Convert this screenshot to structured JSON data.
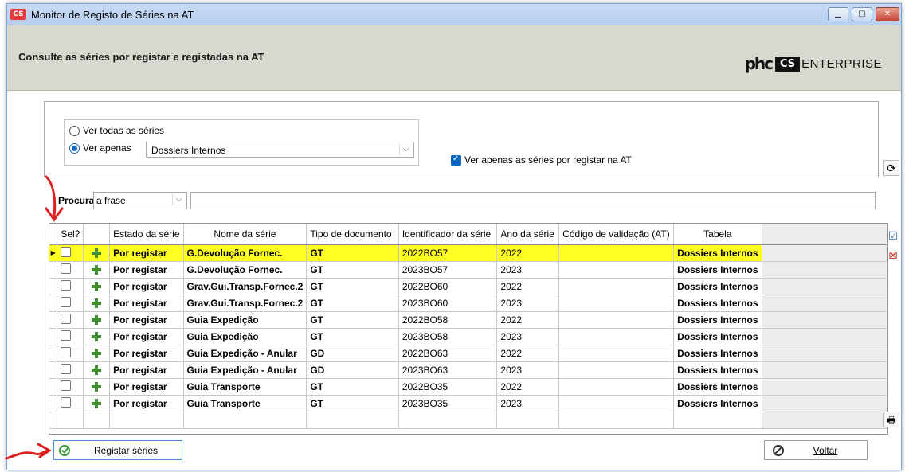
{
  "window": {
    "title": "Monitor de Registo de Séries na AT",
    "app_icon_text": "CS"
  },
  "header": {
    "title": "Consulte as séries por registar e registadas na AT",
    "logo": {
      "phc": "phc",
      "cs": "CS",
      "enterprise": "ENTERPRISE"
    }
  },
  "filters": {
    "radio_all_label": "Ver todas as séries",
    "radio_only_label": "Ver apenas",
    "selected_radio": "Ver apenas",
    "only_value": "Dossiers Internos",
    "register_only_label": "Ver apenas as séries por registar na AT",
    "register_only_checked": true
  },
  "search": {
    "label": "Procura",
    "mode": "a frase",
    "text": ""
  },
  "grid": {
    "columns": [
      "Sel?",
      "",
      "Estado da série",
      "Nome da série",
      "Tipo de documento",
      "Identificador da série",
      "Ano da série",
      "Código de validação (AT)",
      "Tabela"
    ],
    "rows": [
      {
        "sel": false,
        "estado": "Por registar",
        "nome": "G.Devolução Fornec.",
        "tipo": "GT",
        "id": "2022BO57",
        "ano": "2022",
        "codigo": "",
        "tabela": "Dossiers Internos",
        "selected": true
      },
      {
        "sel": false,
        "estado": "Por registar",
        "nome": "G.Devolução Fornec.",
        "tipo": "GT",
        "id": "2023BO57",
        "ano": "2023",
        "codigo": "",
        "tabela": "Dossiers Internos"
      },
      {
        "sel": false,
        "estado": "Por registar",
        "nome": "Grav.Gui.Transp.Fornec.2",
        "tipo": "GT",
        "id": "2022BO60",
        "ano": "2022",
        "codigo": "",
        "tabela": "Dossiers Internos"
      },
      {
        "sel": false,
        "estado": "Por registar",
        "nome": "Grav.Gui.Transp.Fornec.2",
        "tipo": "GT",
        "id": "2023BO60",
        "ano": "2023",
        "codigo": "",
        "tabela": "Dossiers Internos"
      },
      {
        "sel": false,
        "estado": "Por registar",
        "nome": "Guia Expedição",
        "tipo": "GT",
        "id": "2022BO58",
        "ano": "2022",
        "codigo": "",
        "tabela": "Dossiers Internos"
      },
      {
        "sel": false,
        "estado": "Por registar",
        "nome": "Guia Expedição",
        "tipo": "GT",
        "id": "2023BO58",
        "ano": "2023",
        "codigo": "",
        "tabela": "Dossiers Internos"
      },
      {
        "sel": false,
        "estado": "Por registar",
        "nome": "Guia Expedição - Anular",
        "tipo": "GD",
        "id": "2022BO63",
        "ano": "2022",
        "codigo": "",
        "tabela": "Dossiers Internos"
      },
      {
        "sel": false,
        "estado": "Por registar",
        "nome": "Guia Expedição - Anular",
        "tipo": "GD",
        "id": "2023BO63",
        "ano": "2023",
        "codigo": "",
        "tabela": "Dossiers Internos"
      },
      {
        "sel": false,
        "estado": "Por registar",
        "nome": "Guia Transporte",
        "tipo": "GT",
        "id": "2022BO35",
        "ano": "2022",
        "codigo": "",
        "tabela": "Dossiers Internos"
      },
      {
        "sel": false,
        "estado": "Por registar",
        "nome": "Guia Transporte",
        "tipo": "GT",
        "id": "2023BO35",
        "ano": "2023",
        "codigo": "",
        "tabela": "Dossiers Internos"
      }
    ]
  },
  "buttons": {
    "register": "Registar séries",
    "back": "Voltar"
  },
  "colors": {
    "selected_row": "#ffff22",
    "accent": "#0a66c2",
    "annotation": "#e02020"
  }
}
